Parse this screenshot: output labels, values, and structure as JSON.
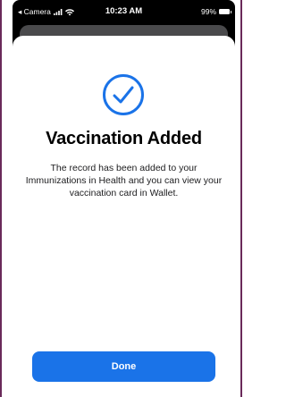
{
  "status_bar": {
    "carrier": "◂ Camera",
    "time": "10:23 AM",
    "battery_percent": "99%"
  },
  "sheet": {
    "icon": "checkmark-circle-icon",
    "title": "Vaccination Added",
    "message": "The record has been added to your Immunizations in Health and you can view your vaccination card in Wallet.",
    "done_label": "Done"
  },
  "colors": {
    "accent": "#1a73e8",
    "check": "#1a73e8",
    "border": "#6a2a5a"
  }
}
